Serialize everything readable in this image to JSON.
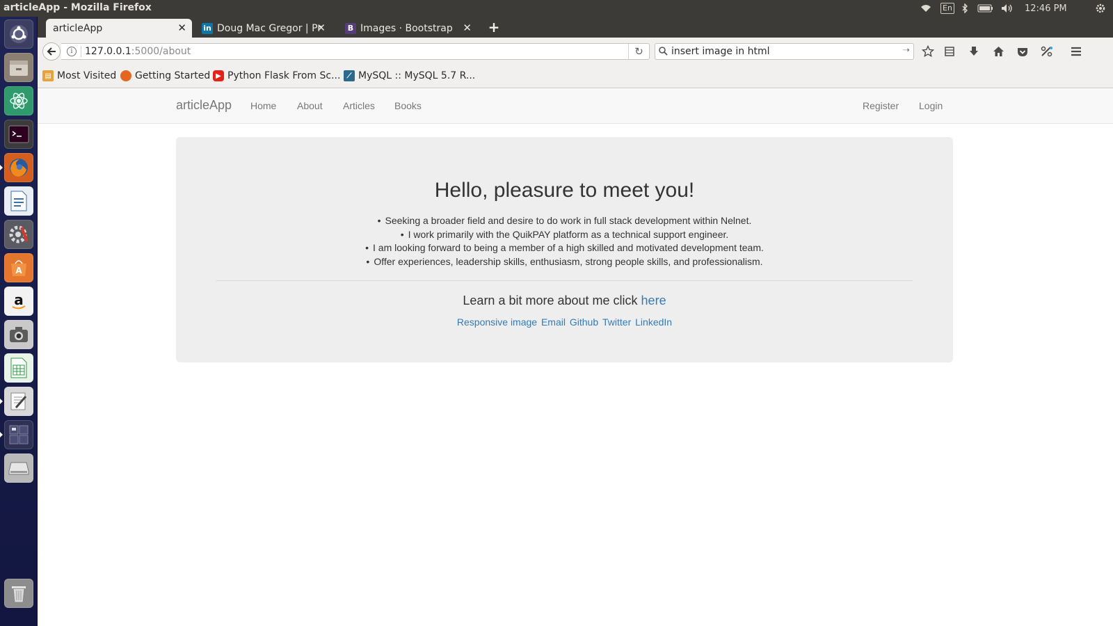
{
  "os_panel": {
    "window_title": "articleApp - Mozilla Firefox",
    "keyboard_layout": "En",
    "clock": "12:46 PM"
  },
  "launcher": {
    "items": [
      "ubuntu-dash",
      "files",
      "atom-editor",
      "terminal",
      "firefox",
      "libreoffice-writer",
      "system-settings",
      "software-center",
      "amazon",
      "screenshot",
      "libreoffice-calc",
      "text-editor",
      "workspace-switcher",
      "removable-drive",
      "trash"
    ]
  },
  "browser": {
    "tabs": [
      {
        "label": "articleApp",
        "active": true
      },
      {
        "label": "Doug Mac Gregor | Pro",
        "icon": "linkedin-icon"
      },
      {
        "label": "Images · Bootstrap",
        "icon": "bootstrap-icon"
      }
    ],
    "url": {
      "host": "127.0.0.1",
      "path": ":5000/about"
    },
    "search": {
      "value": "insert image in html"
    },
    "bookmarks": [
      {
        "label": "Most Visited",
        "icon": "folder-icon"
      },
      {
        "label": "Getting Started",
        "icon": "firefox-icon"
      },
      {
        "label": "Python Flask From Sc...",
        "icon": "youtube-icon"
      },
      {
        "label": "MySQL :: MySQL 5.7 R...",
        "icon": "mysql-icon"
      }
    ]
  },
  "site": {
    "brand": "articleApp",
    "nav_left": [
      "Home",
      "About",
      "Articles",
      "Books"
    ],
    "nav_right": [
      "Register",
      "Login"
    ],
    "jumbotron": {
      "heading": "Hello, pleasure to meet you!",
      "bullets": [
        "Seeking a broader field and desire to do work in full stack development within Nelnet.",
        "I work primarily with the QuikPAY platform as a technical support engineer.",
        "I am looking forward to being a member of a high skilled and motivated development team.",
        "Offer experiences, leadership skills, enthusiasm, strong people skills, and professionalism."
      ],
      "learn_more_prefix": "Learn a bit more about me click",
      "learn_more_link": "here",
      "links": [
        "Responsive image",
        "Email",
        "Github",
        "Twitter",
        "LinkedIn"
      ]
    },
    "colors": {
      "link": "#337ab7",
      "navbar_bg": "#f8f8f8",
      "jumbotron_bg": "#eeeeee"
    }
  }
}
